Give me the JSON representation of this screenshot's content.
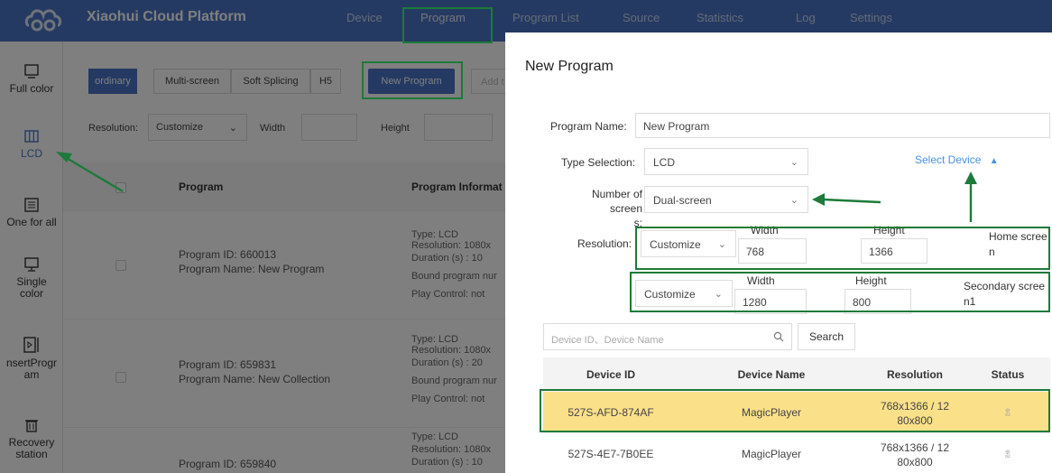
{
  "app": {
    "brand": "Xiaohui Cloud Platform"
  },
  "nav": [
    "Device",
    "Program",
    "Program List",
    "Source",
    "Statistics",
    "Log",
    "Settings"
  ],
  "sidebar": {
    "items": [
      {
        "label": "Full color",
        "icon": "monitor-icon"
      },
      {
        "label": "LCD",
        "icon": "columns-icon"
      },
      {
        "label": "One for all",
        "icon": "list-icon"
      },
      {
        "label": "Single color",
        "icon": "display-icon"
      },
      {
        "label": "nsertProgr am",
        "icon": "insert-icon"
      },
      {
        "label": "Recovery station",
        "icon": "trash-icon"
      }
    ]
  },
  "toolbar": {
    "modes": [
      "ordinary",
      "Multi-screen",
      "Soft Splicing",
      "H5"
    ],
    "new_program": "New Program",
    "add": "Add t"
  },
  "filters": {
    "resolution_label": "Resolution:",
    "resolution_value": "Customize",
    "width_label": "Width",
    "height_label": "Height"
  },
  "table": {
    "headers": [
      "Program",
      "Program Informat"
    ],
    "rows": [
      {
        "id": "Program ID: 660013",
        "name": "Program Name: New Program",
        "info": [
          "Type: LCD",
          "Resolution: 1080x",
          "Duration (s) : 10",
          "Bound program nur",
          "Play Control:  not"
        ]
      },
      {
        "id": "Program ID: 659831",
        "name": "Program Name: New Collection",
        "info": [
          "Type: LCD",
          "Resolution: 1080x",
          "Duration (s) : 20",
          "Bound program nur",
          "Play Control:  not"
        ]
      },
      {
        "id": "Program ID: 659840",
        "name": "",
        "info": [
          "Type: LCD",
          "Resolution: 1080x",
          "Duration (s) : 10"
        ]
      }
    ]
  },
  "modal": {
    "title": "New Program",
    "program_name_label": "Program Name:",
    "program_name_value": "New Program",
    "type_label": "Type Selection:",
    "type_value": "LCD",
    "screens_label_1": "Number of screen",
    "screens_label_2": "s:",
    "screens_value": "Dual-screen",
    "select_device": "Select Device",
    "resolution_label": "Resolution:",
    "width_label": "Width",
    "height_label": "Height",
    "home": {
      "mode": "Customize",
      "width": "768",
      "height": "1366",
      "label_1": "Home scree",
      "label_2": "n"
    },
    "secondary": {
      "mode": "Customize",
      "width": "1280",
      "height": "800",
      "label_1": "Secondary scree",
      "label_2": "n1"
    },
    "search_placeholder": "Device ID、Device Name",
    "search_button": "Search",
    "device_headers": [
      "Device ID",
      "Device Name",
      "Resolution",
      "Status"
    ],
    "devices": [
      {
        "id": "527S-AFD-874AF",
        "name": "MagicPlayer",
        "res_1": "768x1366 / 12",
        "res_2": "80x800",
        "status": "ꂭ"
      },
      {
        "id": "527S-4E7-7B0EE",
        "name": "MagicPlayer",
        "res_1": "768x1366 / 12",
        "res_2": "80x800",
        "status": "ꂭ"
      }
    ]
  },
  "colors": {
    "brand": "#4a74c4",
    "highlight_row": "#fbe08a",
    "annotation": "#1d7a3a",
    "link": "#4a90e2"
  }
}
